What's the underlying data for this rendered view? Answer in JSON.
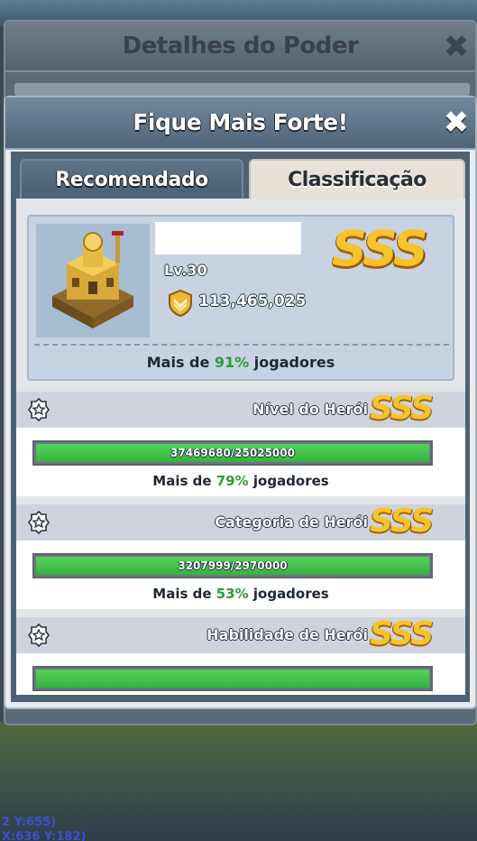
{
  "back_panel": {
    "title": "Detalhes do Poder",
    "close_glyph": "✖"
  },
  "dialog": {
    "title": "Fique Mais Forte!",
    "close_glyph": "✖"
  },
  "tabs": [
    {
      "label": "Recomendado",
      "active": false
    },
    {
      "label": "Classificação",
      "active": true
    }
  ],
  "summary": {
    "level": "Lv.30",
    "power": "113,465,025",
    "grade": "SSS",
    "pct_prefix": "Mais de ",
    "pct_value": "91%",
    "pct_suffix": " jogadores"
  },
  "categories": [
    {
      "title": "Nível do Herói",
      "grade": "SSS",
      "bar_text": "37469680/25025000",
      "progress": 1.0,
      "pct_prefix": "Mais de ",
      "pct_value": "79%",
      "pct_suffix": " jogadores"
    },
    {
      "title": "Categoria de Herói",
      "grade": "SSS",
      "bar_text": "3207999/2970000",
      "progress": 1.0,
      "pct_prefix": "Mais de ",
      "pct_value": "53%",
      "pct_suffix": " jogadores"
    },
    {
      "title": "Habilidade de Herói",
      "grade": "SSS",
      "bar_text": "",
      "progress": 1.0
    }
  ],
  "background": {
    "coord_line1": "2 Y:655)",
    "coord_line2": "X:636 Y:182)"
  },
  "colors": {
    "grade_gold": "#f6c42a",
    "progress_green": "#3cbf44",
    "pct_green": "#2e9a3c"
  },
  "icons": {
    "power": "shield-chevron-icon",
    "category": "badge-star-icon",
    "close": "close-icon"
  }
}
